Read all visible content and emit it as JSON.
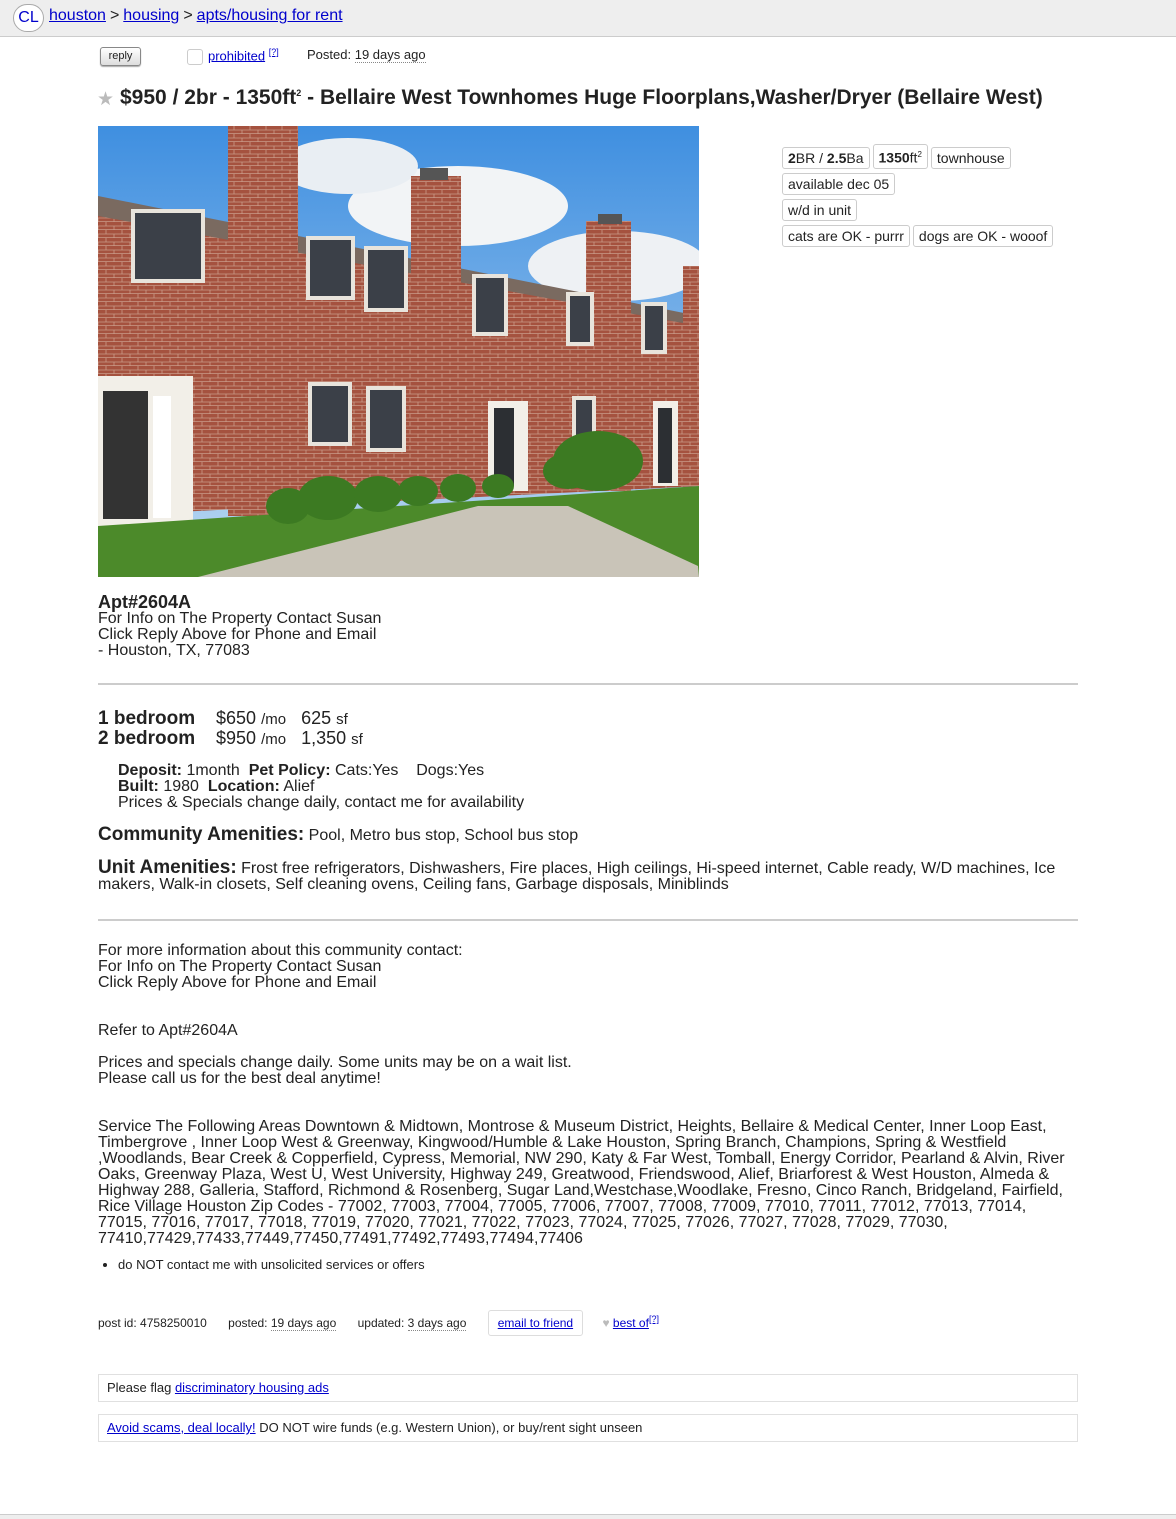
{
  "nav": {
    "logo": "CL",
    "crumbs": [
      "houston",
      "housing",
      "apts/housing for rent"
    ],
    "separator": ">"
  },
  "actions": {
    "reply": "reply",
    "prohibited": "prohibited",
    "help_mark": "[?]",
    "posted_label": "Posted:",
    "posted_value": "19 days ago"
  },
  "title": {
    "price": "$950",
    "slash_br": "/ 2br - 1350ft",
    "sup": "2",
    "name": " - Bellaire West Townhomes Huge Floorplans,Washer/Dryer",
    "hood": " (Bellaire West)"
  },
  "attributes": {
    "br": "2",
    "br_unit": "BR / ",
    "ba": "2.5",
    "ba_unit": "Ba",
    "sqft": "1350",
    "sqft_unit": "ft",
    "sqft_sup": "2",
    "type": "townhouse",
    "available": "available dec 05",
    "laundry": "w/d in unit",
    "cats": "cats are OK - purrr",
    "dogs": "dogs are OK - wooof"
  },
  "address": {
    "heading": "Apt#2604A",
    "line1": "For Info on The Property Contact Susan",
    "line2": "Click Reply Above for Phone and Email",
    "line3": "- Houston, TX, 77083"
  },
  "units": [
    {
      "label": "1 bedroom",
      "price": "$650",
      "per": "/mo",
      "size": "625",
      "unit": "sf"
    },
    {
      "label": "2 bedroom",
      "price": "$950",
      "per": "/mo",
      "size": "1,350",
      "unit": "sf"
    }
  ],
  "details": {
    "deposit_label": "Deposit:",
    "deposit": "1month",
    "pet_label": "Pet Policy:",
    "pet": "Cats:Yes    Dogs:Yes",
    "built_label": "Built:",
    "built": "1980",
    "location_label": "Location:",
    "location": "Alief",
    "note": "Prices & Specials change daily, contact me for availability"
  },
  "community": {
    "label": "Community Amenities:",
    "value": "Pool, Metro bus stop, School bus stop"
  },
  "unit_amenities": {
    "label": "Unit Amenities:",
    "value": "Frost free refrigerators, Dishwashers, Fire places, High ceilings, Hi-speed internet, Cable ready, W/D machines, Ice makers, Walk-in closets, Self cleaning ovens, Ceiling fans, Garbage disposals, Miniblinds"
  },
  "more_info": {
    "l1": "For more information about this community contact:",
    "l2": "For Info on The Property Contact Susan",
    "l3": "Click Reply Above for Phone and Email",
    "refer": "Refer to Apt#2604A",
    "p1": "Prices and specials change daily. Some units may be on a wait list.",
    "p2": "Please call us for the best deal anytime!",
    "areas": "Service The Following Areas Downtown & Midtown, Montrose & Museum District, Heights, Bellaire & Medical Center, Inner Loop East, Timbergrove , Inner Loop West & Greenway, Kingwood/Humble & Lake Houston, Spring Branch, Champions, Spring & Westfield ,Woodlands, Bear Creek & Copperfield, Cypress, Memorial, NW 290, Katy & Far West, Tomball, Energy Corridor, Pearland & Alvin, River Oaks, Greenway Plaza, West U, West University, Highway 249, Greatwood, Friendswood, Alief, Briarforest & West Houston, Almeda & Highway 288, Galleria, Stafford, Richmond & Rosenberg, Sugar Land,Westchase,Woodlake, Fresno, Cinco Ranch, Bridgeland, Fairfield, Rice Village Houston Zip Codes - 77002, 77003, 77004, 77005, 77006, 77007, 77008, 77009, 77010, 77011, 77012, 77013, 77014, 77015, 77016, 77017, 77018, 77019, 77020, 77021, 77022, 77023, 77024, 77025, 77026, 77027, 77028, 77029, 77030, 77410,77429,77433,77449,77450,77491,77492,77493,77494,77406"
  },
  "notices": [
    "do NOT contact me with unsolicited services or offers"
  ],
  "footer": {
    "post_id_label": "post id:",
    "post_id": "4758250010",
    "posted_label": "posted:",
    "posted": "19 days ago",
    "updated_label": "updated:",
    "updated": "3 days ago",
    "email": "email to friend",
    "best_of": "best of",
    "help_mark": "[?]"
  },
  "flag": {
    "prefix": "Please flag ",
    "link": "discriminatory housing ads"
  },
  "scam": {
    "link": "Avoid scams, deal locally!",
    "text": " DO NOT wire funds (e.g. Western Union), or buy/rent sight unseen"
  }
}
